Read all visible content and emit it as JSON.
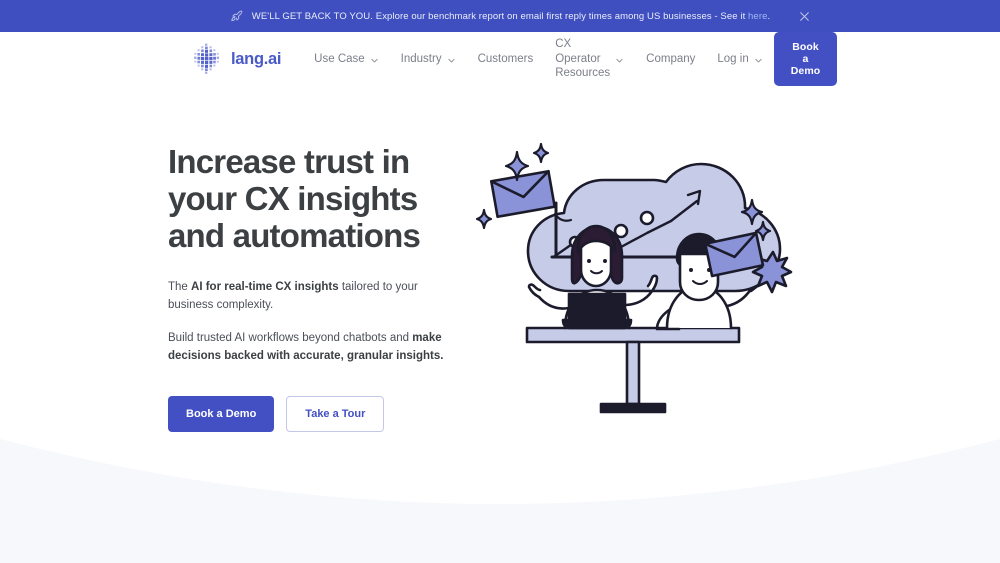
{
  "colors": {
    "banner_bg": "#3f4fbf",
    "brand_blue": "#4250c4",
    "logo_text": "#4a5ac8",
    "heading": "#3c4043",
    "body_text": "#4b4f57",
    "nav_link": "#7c7f8a",
    "link_light": "#9fb8f5",
    "illustration_cloud": "#c6cbe8",
    "illustration_accent": "#8b93d8",
    "section_bg": "#f6f8fb"
  },
  "banner": {
    "icon": "rocket-icon",
    "lead": "WE'LL GET BACK TO YOU.",
    "text": " Explore our benchmark report on email first reply times among US businesses - See it ",
    "link_label": "here",
    "trailing": ".",
    "close_icon": "close-icon"
  },
  "nav": {
    "logo_icon": "lang-ai-logo-icon",
    "brand": "lang.ai",
    "items": [
      {
        "label": "Use Case",
        "has_dropdown": true
      },
      {
        "label": "Industry",
        "has_dropdown": true
      },
      {
        "label": "Customers",
        "has_dropdown": false
      },
      {
        "label": "CX Operator Resources",
        "has_dropdown": true
      },
      {
        "label": "Company",
        "has_dropdown": false
      },
      {
        "label": "Log in",
        "has_dropdown": true
      }
    ],
    "cta_label": "Book a Demo"
  },
  "hero": {
    "title": "Increase trust in your CX insights and automations",
    "paragraph1": {
      "before": "The ",
      "bold": "AI for real-time CX insights",
      "after": " tailored to your business complexity."
    },
    "paragraph2": {
      "before": "Build trusted AI workflows beyond chatbots and ",
      "bold": "make decisions backed with accurate, granular insights."
    },
    "primary_cta": "Book a Demo",
    "secondary_cta": "Take a Tour",
    "illustration_name": "team-data-insights-illustration"
  }
}
